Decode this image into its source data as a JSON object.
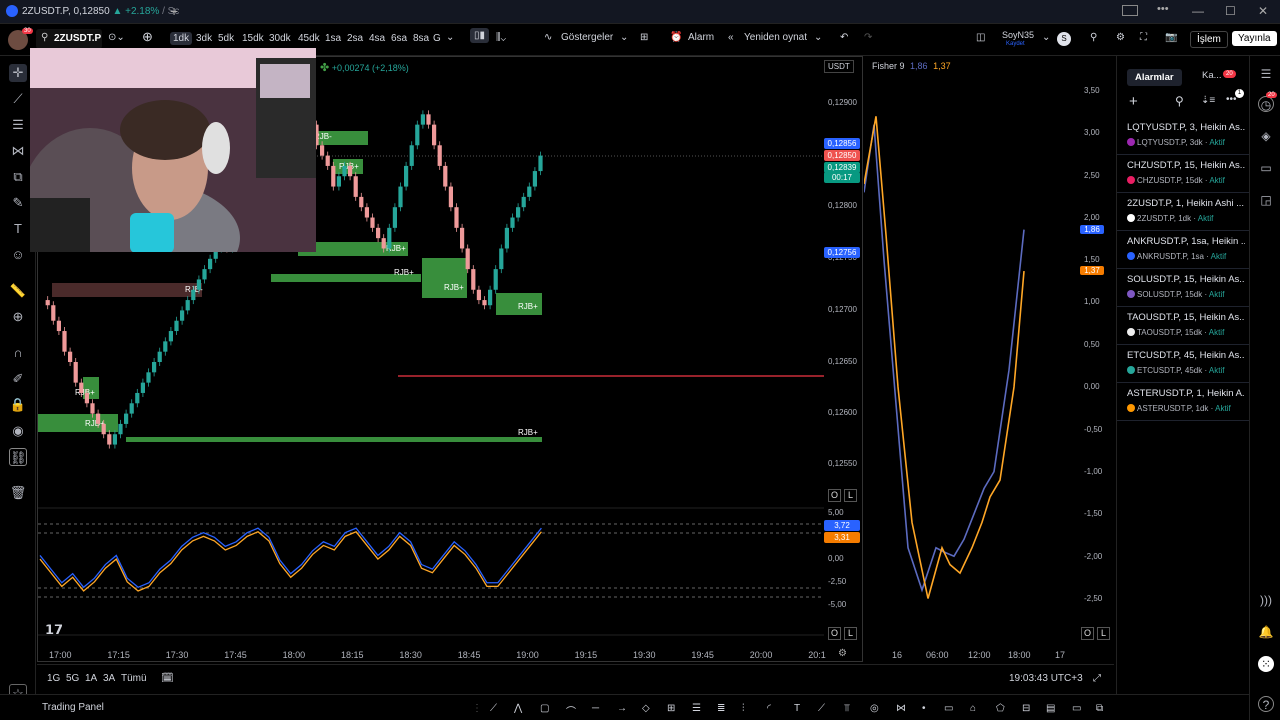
{
  "window": {
    "title": "2ZUSDT.P",
    "price": "0,12850",
    "change": "▲ +2.18%",
    "suffix": "/ Sc",
    "controls": [
      "—",
      "☐",
      "✕"
    ]
  },
  "toolbar": {
    "avatar_badge": "30",
    "symbol": "2ZUSDT.P",
    "timeframes": [
      "1dk",
      "3dk",
      "5dk",
      "15dk",
      "30dk",
      "45dk",
      "1sa",
      "2sa",
      "4sa",
      "6sa",
      "8sa",
      "G"
    ],
    "active_timeframe": "1dk",
    "indicators_label": "Göstergeler",
    "alarm_label": "Alarm",
    "replay_label": "Yeniden oynat",
    "layout_name": "SoyN35",
    "layout_status": "Kaydet",
    "trade_label": "İşlem",
    "publish_label": "Yayınla",
    "s_badge": "S"
  },
  "main_chart": {
    "change_text": "+0,00274 (+2,18%)",
    "currency": "USDT",
    "price_labels": [
      "0,12900",
      "0,12850",
      "0,12800",
      "0,12750",
      "0,12700",
      "0,12650",
      "0,12600",
      "0,12550"
    ],
    "tags": [
      {
        "text": "0,12856",
        "color": "#2962ff"
      },
      {
        "text": "0,12850",
        "color": "#ef5350"
      },
      {
        "text": "0,12839",
        "color": "#089981"
      },
      {
        "text": "00:17",
        "color": "#089981"
      },
      {
        "text": "0,12756",
        "color": "#2962ff"
      }
    ],
    "zone_labels": [
      "RJB-",
      "RJB+",
      "RJB+",
      "RJB+",
      "RJB+",
      "RJB+",
      "RJB-",
      "RJB+",
      "RJB+",
      "RJB+"
    ],
    "oscillator_labels": [
      "5,00",
      "2,50",
      "0,00",
      "-2,50",
      "-5,00"
    ],
    "oscillator_tags": [
      {
        "text": "3,72",
        "color": "#2962ff"
      },
      {
        "text": "3,31",
        "color": "#f57c00"
      }
    ],
    "time_labels": [
      "17:00",
      "17:15",
      "17:30",
      "17:45",
      "18:00",
      "18:15",
      "18:30",
      "18:45",
      "19:00",
      "19:15",
      "19:30",
      "19:45",
      "20:00",
      "20:1"
    ],
    "scale_buttons": [
      "O",
      "L"
    ]
  },
  "right_chart": {
    "indicator": "Fisher 9",
    "value1": "1,86",
    "value2": "1,37",
    "scale_labels": [
      "3,50",
      "3,00",
      "2,50",
      "2,00",
      "1,50",
      "1,00",
      "0,50",
      "0,00",
      "-0,50",
      "-1,00",
      "-1,50",
      "-2,00",
      "-2,50"
    ],
    "tag1": "1,86",
    "tag2": "1,37",
    "time_labels": [
      "16",
      "06:00",
      "12:00",
      "18:00",
      "17"
    ],
    "scale_buttons": [
      "O",
      "L"
    ]
  },
  "alarms_panel": {
    "tab_alarms": "Alarmlar",
    "tab_other": "Ka...",
    "tab_badge": "20",
    "items": [
      {
        "title": "LQTYUSDT.P, 3, Heikin As...",
        "sub": "LQTYUSDT.P, 3dk",
        "status": "Aktif",
        "color": "#9c27b0"
      },
      {
        "title": "CHZUSDT.P, 15, Heikin As...",
        "sub": "CHZUSDT.P, 15dk",
        "status": "Aktif",
        "color": "#e91e63"
      },
      {
        "title": "2ZUSDT.P, 1, Heikin Ashi ...",
        "sub": "2ZUSDT.P, 1dk",
        "status": "Aktif",
        "color": "#ffffff"
      },
      {
        "title": "ANKRUSDT.P, 1sa, Heikin ...",
        "sub": "ANKRUSDT.P, 1sa",
        "status": "Aktif",
        "color": "#2962ff"
      },
      {
        "title": "SOLUSDT.P, 15, Heikin As...",
        "sub": "SOLUSDT.P, 15dk",
        "status": "Aktif",
        "color": "#7e57c2"
      },
      {
        "title": "TAOUSDT.P, 15, Heikin As...",
        "sub": "TAOUSDT.P, 15dk",
        "status": "Aktif",
        "color": "#eeeeee"
      },
      {
        "title": "ETCUSDT.P, 45, Heikin As...",
        "sub": "ETCUSDT.P, 45dk",
        "status": "Aktif",
        "color": "#26a69a"
      },
      {
        "title": "ASTERUSDT.P, 1, Heikin A...",
        "sub": "ASTERUSDT.P, 1dk",
        "status": "Aktif",
        "color": "#ff9800"
      }
    ],
    "notify_badge": "1"
  },
  "right_strip": {
    "badge": "20"
  },
  "bottom_bar": {
    "ranges": [
      "1G",
      "5G",
      "1A",
      "3A",
      "Tümü"
    ],
    "clock": "19:03:43 UTC+3"
  },
  "footer": {
    "trading_panel": "Trading Panel"
  },
  "colors": {
    "bull": "#26a69a",
    "bear": "#ef9a9a",
    "zone_green": "#388e3c",
    "zone_red": "#4a2a2a",
    "fisher_blue": "#5c6bc0",
    "fisher_orange": "#ffa726",
    "hline_red": "#f23645"
  }
}
